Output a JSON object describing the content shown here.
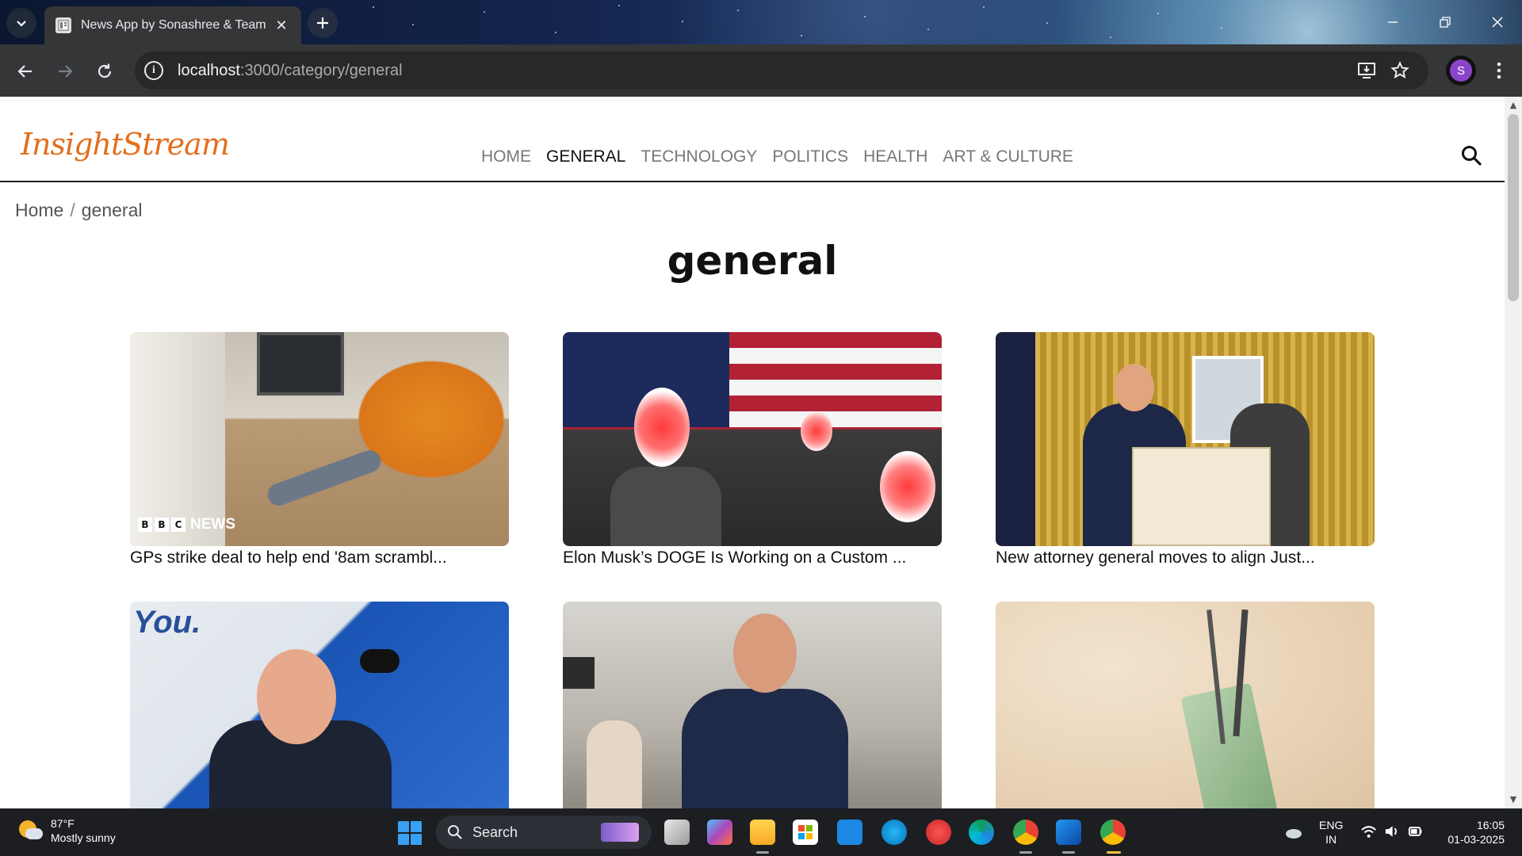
{
  "browser": {
    "tab_title": "News App by Sonashree & Team",
    "url_host": "localhost",
    "url_path": ":3000/category/general",
    "profile_initial": "S"
  },
  "site": {
    "logo": "InsightStream",
    "nav": [
      {
        "label": "HOME",
        "active": false
      },
      {
        "label": "GENERAL",
        "active": true
      },
      {
        "label": "TECHNOLOGY",
        "active": false
      },
      {
        "label": "POLITICS",
        "active": false
      },
      {
        "label": "HEALTH",
        "active": false
      },
      {
        "label": "ART & CULTURE",
        "active": false
      }
    ],
    "breadcrumb": {
      "home": "Home",
      "separator": "/",
      "current": "general"
    },
    "page_title": "general",
    "articles": [
      {
        "title": "GPs strike deal to help end '8am scrambl...",
        "badge": "NEWS"
      },
      {
        "title": "Elon Musk’s DOGE Is Working on a Custom ..."
      },
      {
        "title": "New attorney general moves to align Just..."
      },
      {
        "title": "",
        "image_text": "You."
      },
      {
        "title": ""
      },
      {
        "title": ""
      }
    ]
  },
  "taskbar": {
    "weather_temp": "87°F",
    "weather_desc": "Mostly sunny",
    "search_label": "Search",
    "lang_top": "ENG",
    "lang_bottom": "IN",
    "time": "16:05",
    "date": "01-03-2025"
  },
  "colors": {
    "brand": "#e46e1d",
    "chrome_dark": "#353638",
    "taskbar": "#1c1e22"
  }
}
